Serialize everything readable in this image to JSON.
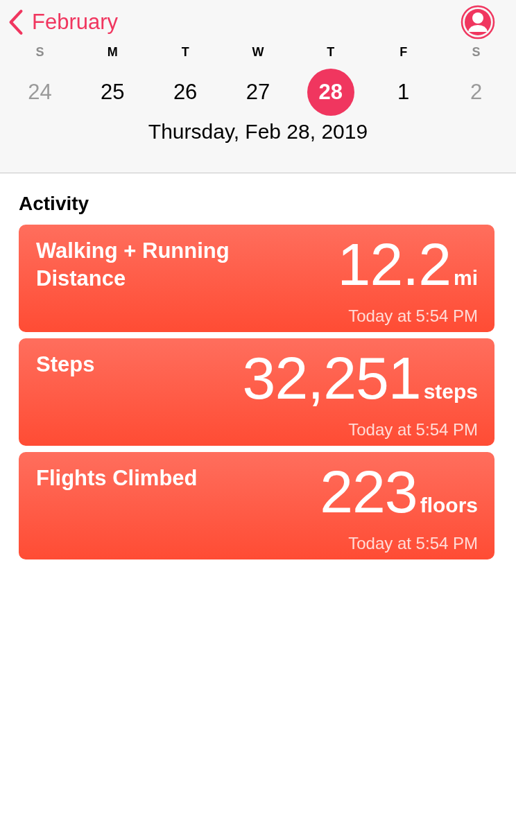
{
  "header": {
    "back_label": "February"
  },
  "days": [
    {
      "weekday": "S",
      "date": "24",
      "selected": false,
      "other_month": true
    },
    {
      "weekday": "M",
      "date": "25",
      "selected": false,
      "other_month": false
    },
    {
      "weekday": "T",
      "date": "26",
      "selected": false,
      "other_month": false
    },
    {
      "weekday": "W",
      "date": "27",
      "selected": false,
      "other_month": false
    },
    {
      "weekday": "T",
      "date": "28",
      "selected": true,
      "other_month": false
    },
    {
      "weekday": "F",
      "date": "1",
      "selected": false,
      "other_month": false
    },
    {
      "weekday": "S",
      "date": "2",
      "selected": false,
      "other_month": true
    }
  ],
  "selected_date": "Thursday, Feb 28, 2019",
  "section_title": "Activity",
  "cards": [
    {
      "title": "Walking + Running Distance",
      "value": "12.2",
      "unit": "mi",
      "time": "Today at 5:54 PM"
    },
    {
      "title": "Steps",
      "value": "32,251",
      "unit": "steps",
      "time": "Today at 5:54 PM"
    },
    {
      "title": "Flights Climbed",
      "value": "223",
      "unit": "floors",
      "time": "Today at 5:54 PM"
    }
  ]
}
